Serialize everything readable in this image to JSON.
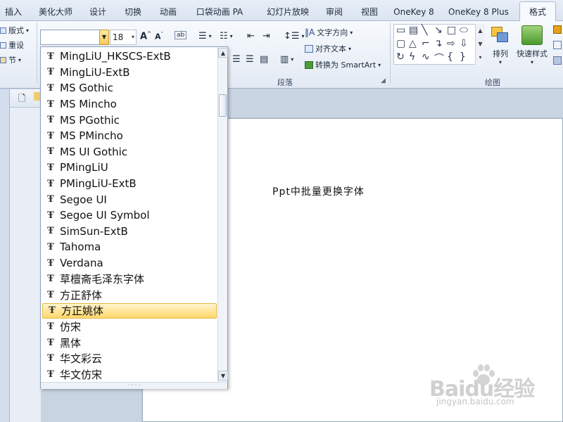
{
  "tabs": [
    "插入",
    "美化大师",
    "设计",
    "切换",
    "动画",
    "口袋动画 PA",
    "幻灯片放映",
    "审阅",
    "视图",
    "OneKey 8",
    "OneKey 8 Plus",
    "格式"
  ],
  "active_tab": "格式",
  "ribbon": {
    "slides_group": {
      "layout_label": "版式",
      "reset_label": "重设",
      "section_label": "节"
    },
    "font_group": {
      "font_name_value": "",
      "font_size_value": "18"
    },
    "paragraph_group": {
      "label": "段落",
      "text_direction_label": "文字方向",
      "align_text_label": "对齐文本",
      "convert_smartart_label": "转换为 SmartArt"
    },
    "drawing_group": {
      "label": "绘图",
      "arrange_label": "排列",
      "quick_styles_label": "快速样式"
    }
  },
  "font_dropdown": {
    "items": [
      "MingLiU_HKSCS-ExtB",
      "MingLiU-ExtB",
      "MS Gothic",
      "MS Mincho",
      "MS PGothic",
      "MS PMincho",
      "MS UI Gothic",
      "PMingLiU",
      "PMingLiU-ExtB",
      "Segoe UI",
      "Segoe UI Symbol",
      "SimSun-ExtB",
      "Tahoma",
      "Verdana",
      "草檀斋毛泽东字体",
      "方正舒体",
      "方正姚体",
      "仿宋",
      "黑体",
      "华文彩云",
      "华文仿宋"
    ],
    "selected": "方正姚体",
    "item_icon": "truetype-font-icon"
  },
  "slide": {
    "text": "Ppt中批量更换字体"
  },
  "watermark": {
    "logo": "Baidu经验",
    "sub": "jingyan.baidu.com"
  },
  "colors": {
    "accent": "#f6c85a",
    "ribbon_bg": "#e3eaf4",
    "selection": "#ffd86a"
  }
}
